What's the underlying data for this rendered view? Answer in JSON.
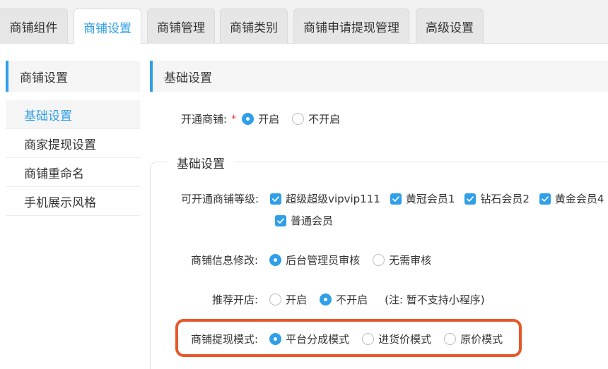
{
  "tabs": [
    {
      "label": "商铺组件"
    },
    {
      "label": "商铺设置"
    },
    {
      "label": "商铺管理"
    },
    {
      "label": "商铺类别"
    },
    {
      "label": "商铺申请提现管理"
    },
    {
      "label": "高级设置"
    }
  ],
  "sidebar": {
    "title": "商铺设置",
    "items": [
      {
        "label": "基础设置"
      },
      {
        "label": "商家提现设置"
      },
      {
        "label": "商铺重命名"
      },
      {
        "label": "手机展示风格"
      }
    ]
  },
  "main": {
    "header": "基础设置",
    "open_shop": {
      "label": "开通商铺:",
      "required_mark": "*",
      "options": [
        "开启",
        "不开启"
      ],
      "selected": "开启"
    },
    "legend": "基础设置",
    "levels": {
      "label": "可开通商铺等级:",
      "options": [
        "超级超级vipvip111",
        "黄冠会员1",
        "钻石会员2",
        "黄金会员4",
        "普通会员"
      ]
    },
    "info_edit": {
      "label": "商铺信息修改:",
      "options": [
        "后台管理员审核",
        "无需审核"
      ],
      "selected": "后台管理员审核"
    },
    "recommend": {
      "label": "推荐开店:",
      "options": [
        "开启",
        "不开启"
      ],
      "selected": "不开启",
      "note": "(注: 暂不支持小程序)"
    },
    "withdraw_mode": {
      "label": "商铺提现模式:",
      "options": [
        "平台分成模式",
        "进货价模式",
        "原价模式"
      ],
      "selected": "平台分成模式"
    }
  },
  "colors": {
    "accent": "#2f9fe8",
    "highlight": "#e8572a",
    "required": "#e53935"
  }
}
